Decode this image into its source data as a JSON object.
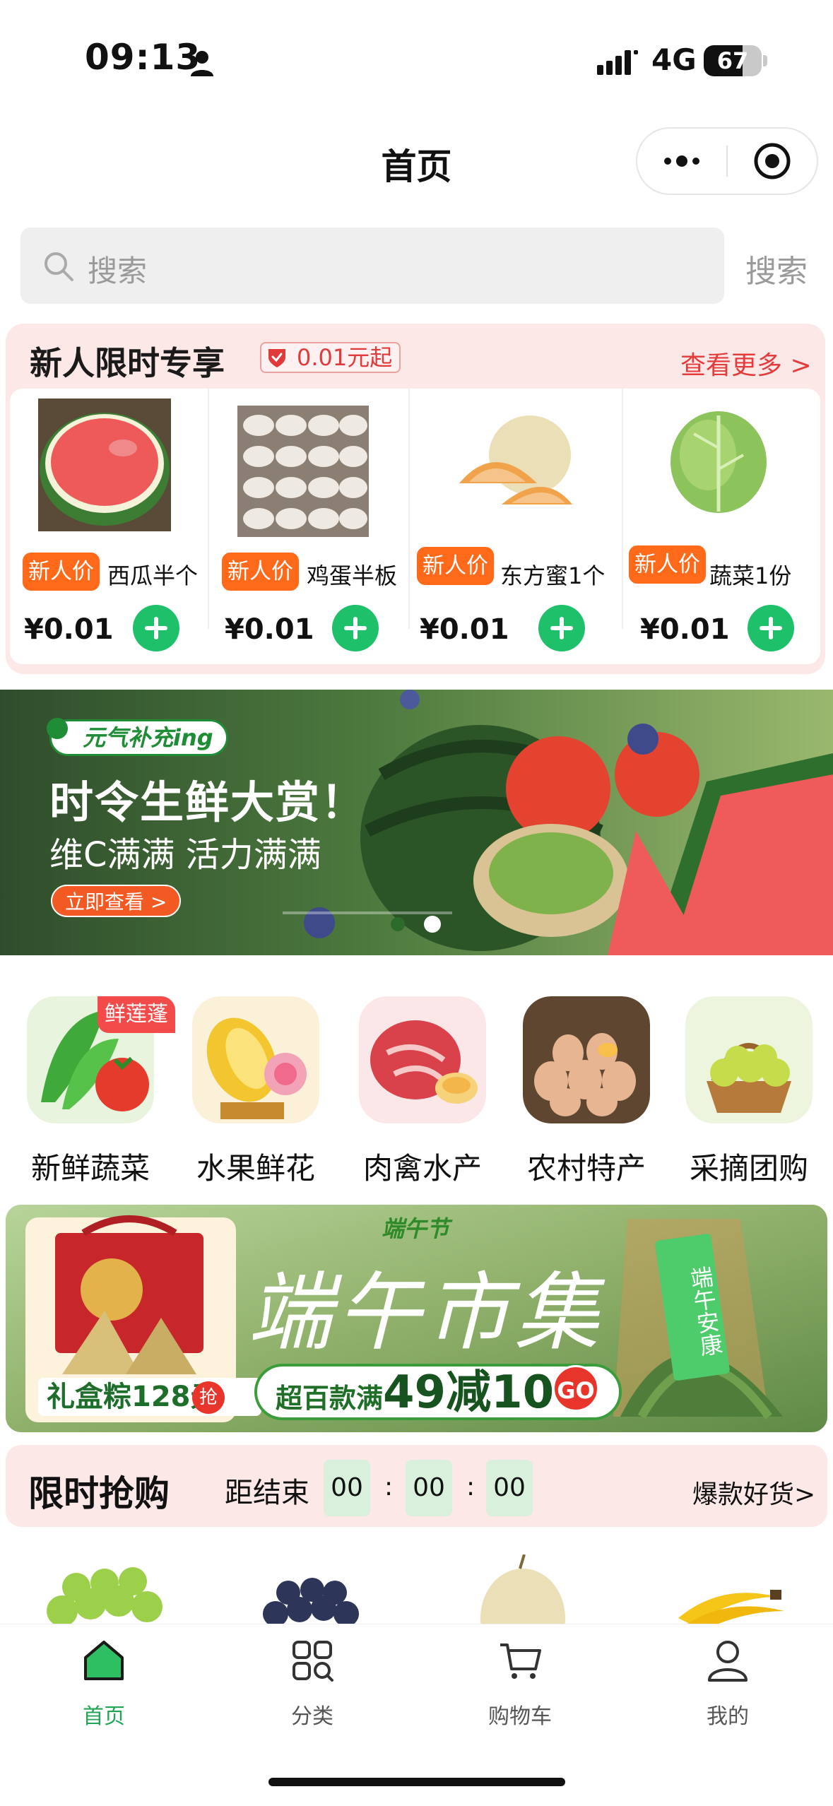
{
  "status_bar": {
    "time": "09:13",
    "network": "4G",
    "battery": "67",
    "battery_level": 0.67
  },
  "nav": {
    "title": "首页",
    "more_icon": "more-dots-icon",
    "close_icon": "target-icon"
  },
  "search": {
    "placeholder": "搜索",
    "button": "搜索"
  },
  "new_user": {
    "title": "新人限时专享",
    "badge": "0.01元起",
    "more": "查看更多 >",
    "items": [
      {
        "tag": "新人价",
        "name": "西瓜半个",
        "price": "¥0.01"
      },
      {
        "tag": "新人价",
        "name": "鸡蛋半板",
        "price": "¥0.01"
      },
      {
        "tag": "新人价",
        "name": "东方蜜1个",
        "price": "¥0.01"
      },
      {
        "tag": "新人价",
        "name": "蔬菜1份",
        "price": "¥0.01"
      }
    ]
  },
  "banner": {
    "tag": "元气补充ing",
    "title": "时令生鲜大赏！",
    "subtitle": "维C满满 活力满满",
    "cta": "立即查看 >"
  },
  "categories": {
    "badge": "鲜莲蓬",
    "items": [
      {
        "label": "新鲜蔬菜"
      },
      {
        "label": "水果鲜花"
      },
      {
        "label": "肉禽水产"
      },
      {
        "label": "农村特产"
      },
      {
        "label": "采摘团购"
      }
    ]
  },
  "festival": {
    "small_label": "端午节",
    "title": "端午市集",
    "box_label": "礼盒粽128元",
    "box_badge": "抢",
    "deal_prefix": "超百款满",
    "deal_main": "49减10",
    "go": "GO",
    "sign": "端午安康"
  },
  "flash_sale": {
    "title": "限时抢购",
    "ends_label": "距结束",
    "hours": "00",
    "minutes": "00",
    "seconds": "00",
    "colon": ":",
    "more": "爆款好货>"
  },
  "tabbar": {
    "items": [
      {
        "label": "首页",
        "icon": "home-icon",
        "active": true
      },
      {
        "label": "分类",
        "icon": "category-icon",
        "active": false
      },
      {
        "label": "购物车",
        "icon": "cart-icon",
        "active": false
      },
      {
        "label": "我的",
        "icon": "user-icon",
        "active": false
      }
    ]
  },
  "colors": {
    "accent_green": "#23a457",
    "price_tag": "#ff6a1a",
    "promo_red": "#e43b3b",
    "panel_pink": "#fde8e8"
  }
}
